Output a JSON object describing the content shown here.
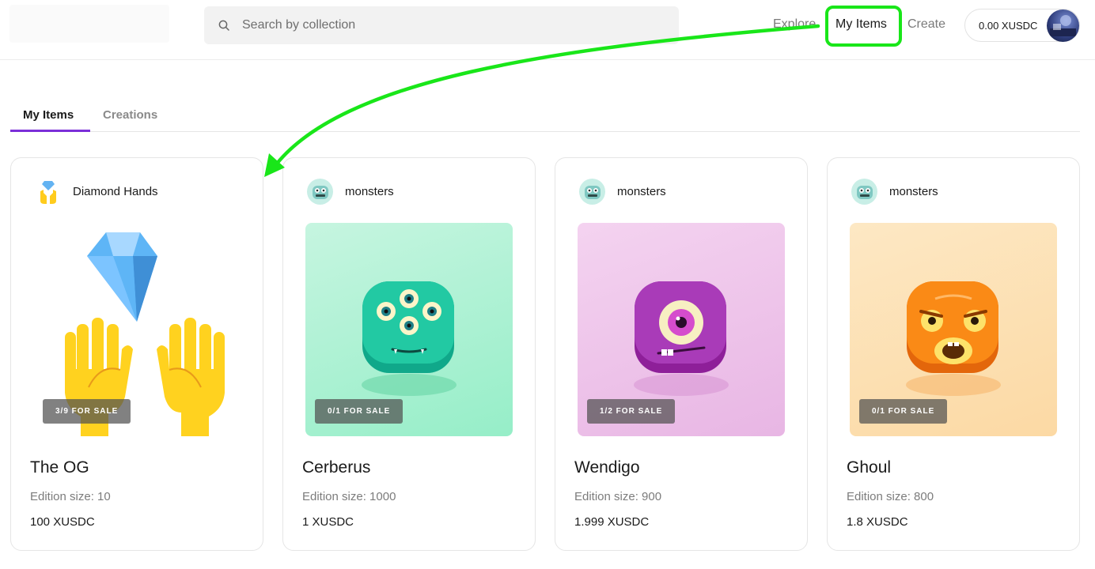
{
  "header": {
    "search_placeholder": "Search by collection",
    "nav": {
      "explore": "Explore",
      "my_items": "My Items",
      "create": "Create"
    },
    "wallet_balance": "0.00 XUSDC"
  },
  "tabs": [
    {
      "label": "My Items",
      "active": true
    },
    {
      "label": "Creations",
      "active": false
    }
  ],
  "accent_color": "#7b2fd8",
  "annotation_color": "#19e619",
  "items": [
    {
      "collection": "Diamond Hands",
      "collection_icon": "raised-hands-diamond-icon",
      "badge": "3/9 FOR SALE",
      "title": "The OG",
      "edition": "Edition size: 10",
      "price": "100 XUSDC",
      "art_bg": "#ffffff"
    },
    {
      "collection": "monsters",
      "collection_icon": "monster-icon",
      "badge": "0/1 FOR SALE",
      "title": "Cerberus",
      "edition": "Edition size: 1000",
      "price": "1 XUSDC",
      "art_bg": "#a8f0cf"
    },
    {
      "collection": "monsters",
      "collection_icon": "monster-icon",
      "badge": "1/2 FOR SALE",
      "title": "Wendigo",
      "edition": "Edition size: 900",
      "price": "1.999 XUSDC",
      "art_bg": "#ecc3ea"
    },
    {
      "collection": "monsters",
      "collection_icon": "monster-icon",
      "badge": "0/1 FOR SALE",
      "title": "Ghoul",
      "edition": "Edition size: 800",
      "price": "1.8 XUSDC",
      "art_bg": "#fde0b4"
    }
  ]
}
